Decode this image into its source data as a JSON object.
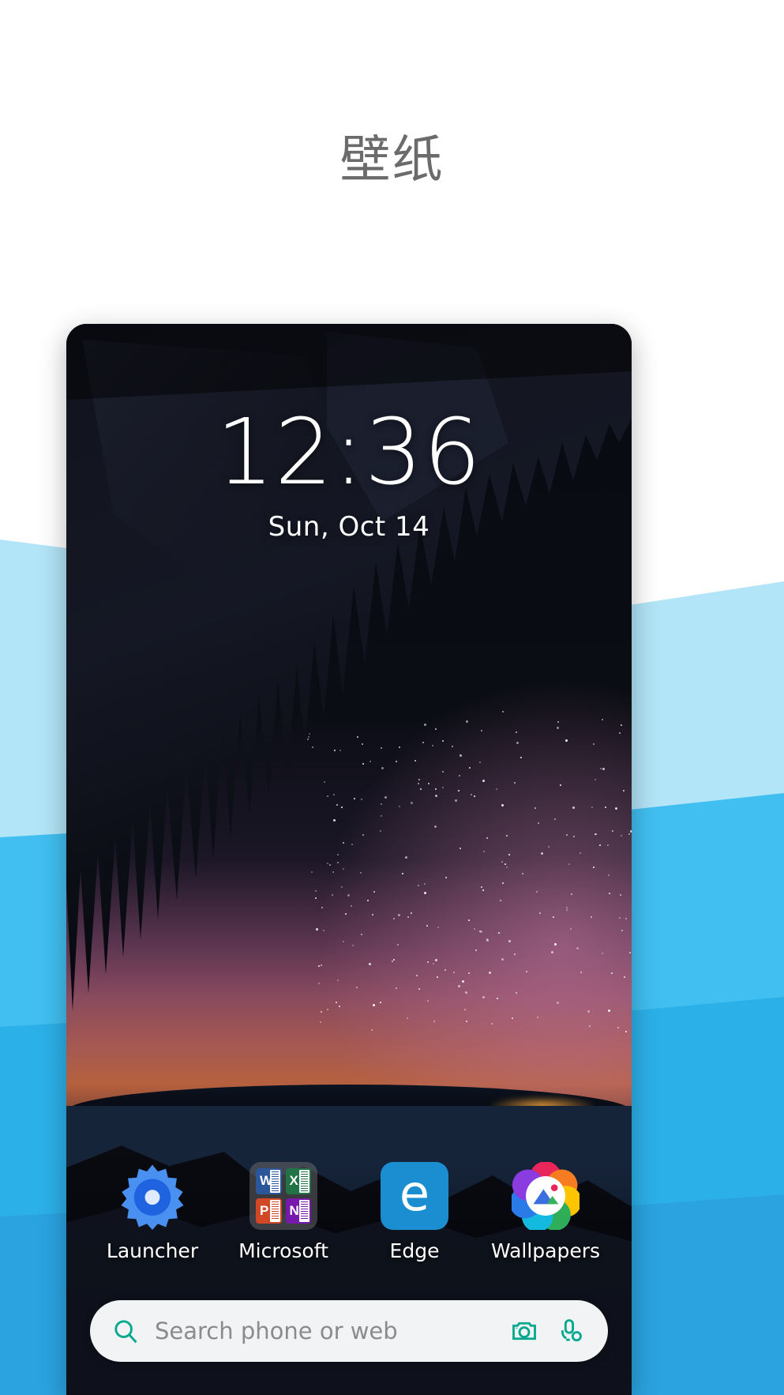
{
  "page": {
    "title": "壁纸",
    "title_color": "#6b6b6b",
    "background_color": "#ffffff"
  },
  "theme": {
    "accent_light_blue": "#b2e5f7",
    "accent_blue": "#41bff0",
    "accent_blue_deep": "#2cb0e8",
    "accent_blue_darker": "#2ba3e0",
    "search_accent": "#00a88e"
  },
  "phone": {
    "lockscreen": {
      "time": "12:36",
      "date": "Sun, Oct 14"
    },
    "apps": [
      {
        "label": "Launcher",
        "icon": "gear-icon",
        "color": "#3b7ff0"
      },
      {
        "label": "Microsoft",
        "icon": "app-folder-icon",
        "color": "#787878"
      },
      {
        "label": "Edge",
        "icon": "edge-icon",
        "color": "#1b8ed1"
      },
      {
        "label": "Wallpapers",
        "icon": "wallpapers-icon",
        "color": "#ffffff"
      }
    ],
    "folder_tiles": [
      {
        "name": "Word",
        "letter": "W",
        "color": "#2b579a"
      },
      {
        "name": "Excel",
        "letter": "X",
        "color": "#217346"
      },
      {
        "name": "PowerPoint",
        "letter": "P",
        "color": "#d24726"
      },
      {
        "name": "OneNote",
        "letter": "N",
        "color": "#7719aa"
      }
    ],
    "search": {
      "placeholder": "Search phone or web",
      "search_icon": "search-icon",
      "camera_icon": "camera-icon",
      "mic_icon": "cortana-mic-icon",
      "icon_color": "#00a88e",
      "field_background": "#f2f3f5"
    }
  }
}
